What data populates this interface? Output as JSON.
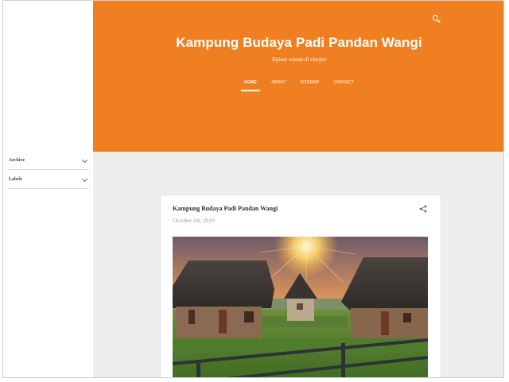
{
  "sidebar": {
    "items": [
      {
        "label": "Archive"
      },
      {
        "label": "Labels"
      }
    ]
  },
  "header": {
    "title": "Kampung Budaya Padi Pandan Wangi",
    "description": "Tujuan wisata di cianjur",
    "search_icon": "search-icon",
    "accent_color": "#f07f22"
  },
  "nav": {
    "tabs": [
      {
        "label": "HOME",
        "active": true
      },
      {
        "label": "ABOUT",
        "active": false
      },
      {
        "label": "SITEMAP",
        "active": false
      },
      {
        "label": "CONTACT",
        "active": false
      }
    ]
  },
  "post": {
    "title": "Kampung Budaya Padi Pandan Wangi",
    "date": "October 04, 2019",
    "share_icon": "share-icon"
  }
}
